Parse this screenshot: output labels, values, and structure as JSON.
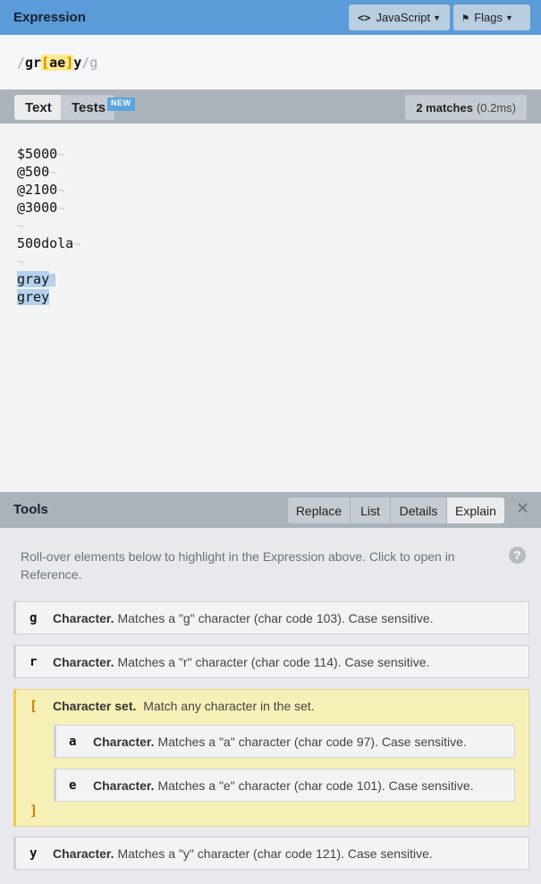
{
  "expression_header": {
    "title": "Expression",
    "flavor_label": "JavaScript",
    "flags_label": "Flags"
  },
  "expression": {
    "open_delim": "/",
    "prefix": "gr",
    "set_open": "[",
    "set_body": "ae",
    "set_close": "]",
    "suffix": "y",
    "close_delim": "/",
    "flags": "g"
  },
  "text_bar": {
    "tab_text": "Text",
    "tab_tests": "Tests",
    "new_badge": "NEW",
    "matches_count": "2 matches",
    "matches_time": "(0.2ms)"
  },
  "text_lines": [
    {
      "text": "$5000",
      "highlight": false
    },
    {
      "text": "@500",
      "highlight": false
    },
    {
      "text": "@2100",
      "highlight": false
    },
    {
      "text": "@3000",
      "highlight": false
    },
    {
      "text": "",
      "highlight": false
    },
    {
      "text": "500dola",
      "highlight": false
    },
    {
      "text": "",
      "highlight": false
    },
    {
      "text": "gray",
      "highlight": true
    },
    {
      "text": "grey",
      "highlight": true,
      "last": true
    }
  ],
  "newline_glyph": "¬",
  "tools": {
    "title": "Tools",
    "tabs": [
      "Replace",
      "List",
      "Details",
      "Explain"
    ],
    "close": "✕",
    "hint": "Roll-over elements below to highlight in the Expression above. Click to open in Reference.",
    "help": "?"
  },
  "explain": {
    "g": {
      "sym": "g",
      "label": "Character.",
      "desc": "Matches a \"g\" character (char code 103). Case sensitive."
    },
    "r": {
      "sym": "r",
      "label": "Character.",
      "desc": "Matches a \"r\" character (char code 114). Case sensitive."
    },
    "set": {
      "open": "[",
      "close": "]",
      "label": "Character set.",
      "desc": "Match any character in the set."
    },
    "a": {
      "sym": "a",
      "label": "Character.",
      "desc": "Matches a \"a\" character (char code 97). Case sensitive."
    },
    "e": {
      "sym": "e",
      "label": "Character.",
      "desc": "Matches a \"e\" character (char code 101). Case sensitive."
    },
    "y": {
      "sym": "y",
      "label": "Character.",
      "desc": "Matches a \"y\" character (char code 121). Case sensitive."
    }
  },
  "colors": {
    "header_blue": "#5a9bd8",
    "match_highlight": "#b5d1ee",
    "set_highlight": "#ffe98a",
    "set_box_bg": "#f6f0b6"
  }
}
